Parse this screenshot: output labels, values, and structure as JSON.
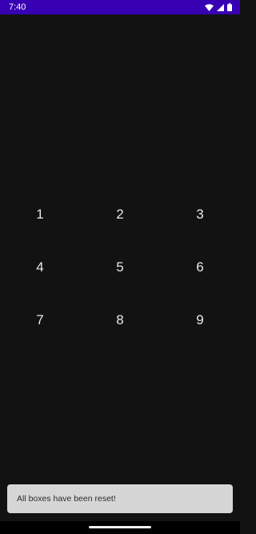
{
  "status_bar": {
    "time": "7:40",
    "icons": [
      "wifi-icon",
      "signal-icon",
      "battery-icon"
    ],
    "background_color": "#3700b3"
  },
  "grid": {
    "cells": [
      "1",
      "2",
      "3",
      "4",
      "5",
      "6",
      "7",
      "8",
      "9"
    ]
  },
  "snackbar": {
    "message": "All boxes have been reset!"
  },
  "theme": {
    "background": "#121212",
    "text": "#e8e8e8",
    "snackbar_background": "#d6d6d6"
  }
}
